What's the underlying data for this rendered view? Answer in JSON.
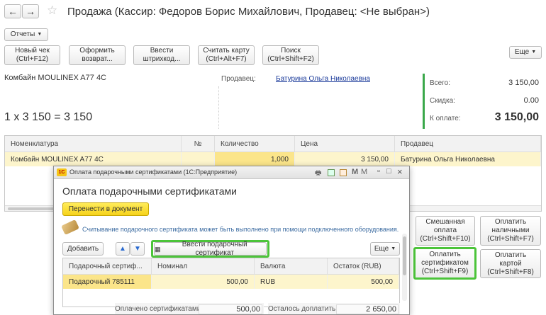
{
  "window": {
    "title": "Продажа (Кассир: Федоров Борис Михайлович, Продавец: <Не выбран>)",
    "nav_back": "←",
    "nav_forward": "→",
    "star": "☆"
  },
  "toolbar": {
    "reports_label": "Отчеты",
    "buttons": [
      {
        "line1": "Новый чек",
        "line2": "(Ctrl+F12)"
      },
      {
        "line1": "Оформить",
        "line2": "возврат..."
      },
      {
        "line1": "Ввести",
        "line2": "штрихкод..."
      },
      {
        "line1": "Считать карту",
        "line2": "(Ctrl+Alt+F7)"
      },
      {
        "line1": "Поиск",
        "line2": "(Ctrl+Shift+F2)"
      }
    ],
    "more_label": "Еще"
  },
  "product": {
    "name": "Комбайн MOULINEX  A77 4C",
    "formula": "1 x 3 150 = 3 150",
    "seller_label": "Продавец:",
    "seller_value": "Батурина Ольга Николаевна"
  },
  "totals": {
    "total_label": "Всего:",
    "total_value": "3 150,00",
    "discount_label": "Скидка:",
    "discount_value": "0.00",
    "topay_label": "К оплате:",
    "topay_value": "3 150,00"
  },
  "grid": {
    "headers": [
      "Номенклатура",
      "№",
      "Количество",
      "Цена",
      "Продавец"
    ],
    "rows": [
      {
        "name": "Комбайн MOULINEX  A77 4C",
        "num": "",
        "qty": "1,000",
        "price": "3 150,00",
        "seller": "Батурина Ольга Николаевна"
      }
    ]
  },
  "right_buttons": [
    {
      "line1": "Смешанная",
      "line2": "оплата",
      "line3": "(Ctrl+Shift+F10)"
    },
    {
      "line1": "Оплатить",
      "line2": "наличными",
      "line3": "(Ctrl+Shift+F7)"
    },
    {
      "line1": "Оплатить",
      "line2": "сертификатом",
      "line3": "(Ctrl+Shift+F9)"
    },
    {
      "line1": "Оплатить",
      "line2": "картой",
      "line3": "(Ctrl+Shift+F8)"
    }
  ],
  "dialog": {
    "window_title": "Оплата подарочными сертификатами (1С:Предприятие)",
    "heading": "Оплата подарочными сертификатами",
    "transfer_btn": "Перенести в документ",
    "info_text": "Считывание подарочного сертификата может быть выполнено при помощи подключенного оборудования.",
    "add_btn": "Добавить",
    "enter_cert_btn": "Ввести подарочный сертификат",
    "more_label": "Еще",
    "headers": [
      "Подарочный сертиф...",
      "Номинал",
      "Валюта",
      "Остаток (RUB)"
    ],
    "rows": [
      {
        "cert": "Подарочный 785111",
        "nominal": "500,00",
        "currency": "RUB",
        "rest": "500,00"
      }
    ],
    "paid_label": "Оплачено сертификатами:",
    "paid_value": "500,00",
    "remain_label": "Осталось доплатить:",
    "remain_value": "2 650,00"
  }
}
